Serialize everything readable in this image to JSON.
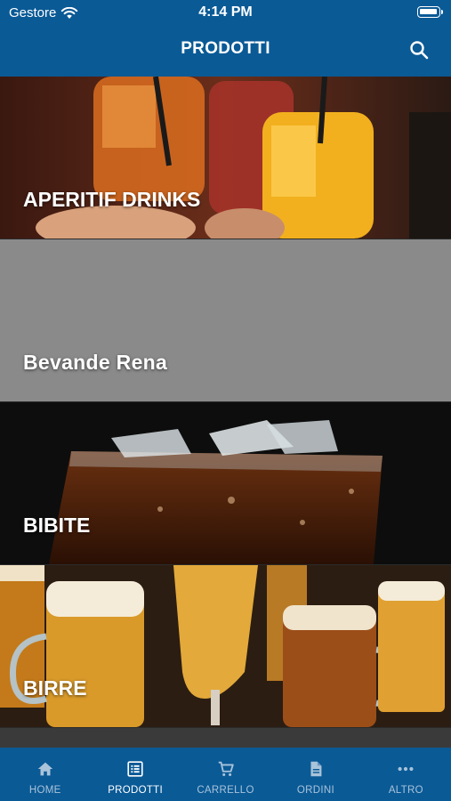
{
  "status": {
    "carrier": "Gestore",
    "time": "4:14 PM"
  },
  "header": {
    "title": "PRODOTTI"
  },
  "categories": [
    {
      "label": "APERITIF DRINKS"
    },
    {
      "label": "Bevande Rena"
    },
    {
      "label": "BIBITE"
    },
    {
      "label": "BIRRE"
    }
  ],
  "tabs": [
    {
      "label": "HOME",
      "icon": "home-icon"
    },
    {
      "label": "PRODOTTI",
      "icon": "list-icon"
    },
    {
      "label": "CARRELLO",
      "icon": "cart-icon"
    },
    {
      "label": "ORDINI",
      "icon": "document-icon"
    },
    {
      "label": "ALTRO",
      "icon": "more-icon"
    }
  ],
  "colors": {
    "primary": "#0a5a96",
    "tab_inactive": "#a9c3da",
    "placeholder_grey": "#8a8a8a"
  }
}
